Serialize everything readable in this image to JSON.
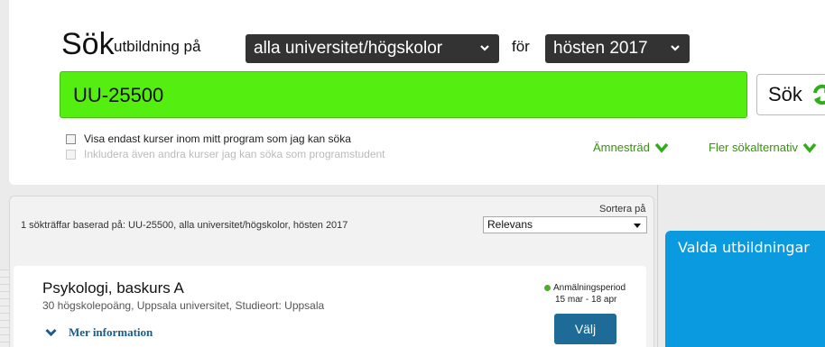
{
  "search": {
    "heading": "Sök",
    "edu_label": "utbildning på",
    "university_select": "alla universitet/högskolor",
    "for_label": "för",
    "term_select": "hösten 2017",
    "query": "UU-25500",
    "button_label": "Sök",
    "checkbox_only_program": "Visa endast kurser inom mitt program som jag kan söka",
    "checkbox_include_other": "Inkludera även andra kurser jag kan söka som programstudent",
    "subject_tree_link": "Ämnesträd",
    "more_options_link": "Fler sökalternativ"
  },
  "results": {
    "count_text": "1 sökträffar baserad på: UU-25500, alla universitet/högskolor, hösten 2017",
    "sort_label": "Sortera på",
    "sort_value": "Relevans",
    "items": [
      {
        "title": "Psykologi, baskurs A",
        "meta": "30 högskolepoäng, Uppsala universitet, Studieort: Uppsala",
        "more_info": "Mer information",
        "status": "Anmälningsperiod",
        "dates": "15 mar - 18 apr",
        "choose": "Välj"
      }
    ]
  },
  "selected": {
    "title": "Valda utbildningar"
  },
  "colors": {
    "search_bg": "#55ee11",
    "accent_blue": "#0a9ae0",
    "button_blue": "#1f6b98",
    "link_green": "#3a8f12"
  }
}
